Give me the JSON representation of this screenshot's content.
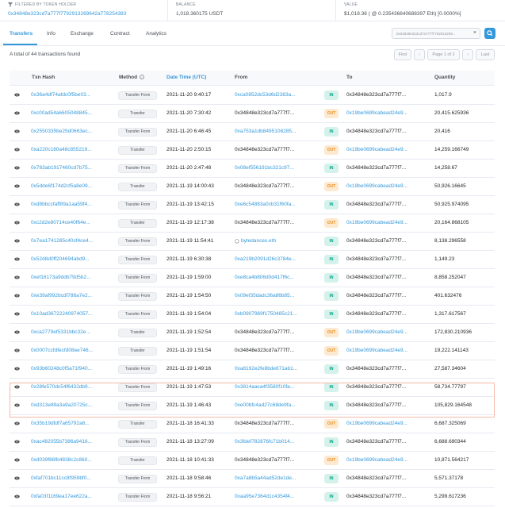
{
  "summary": {
    "filter_label": "FILTERED BY TOKEN HOLDER",
    "holder_address": "0x34848e323cd7a777f7792913269642a778254393",
    "balance_label": "BALANCE",
    "balance_value": "1,018.360175 USDT",
    "value_label": "VALUE",
    "value_value": "$1,018.36 ( @ 0.235436640688397 Eth) [0.0000%]"
  },
  "tabs": [
    "Transfers",
    "Info",
    "Exchange",
    "Contract",
    "Analytics"
  ],
  "search": {
    "value": "0x34848e323cd7a777f7792913269...",
    "clear": "×"
  },
  "total_text": "A total of 44 transactions found",
  "pagination": {
    "first": "First",
    "prev": "‹",
    "page": "Page 1 of 2",
    "next": "›",
    "last": "Last"
  },
  "columns": {
    "hash": "Txn Hash",
    "method": "Method",
    "age": "Date Time (UTC)",
    "from": "From",
    "to": "To",
    "qty": "Quantity"
  },
  "rows": [
    {
      "hash": "0x36a4df74afdc0f5be03...",
      "method": "Transfer From",
      "time": "2021-11-20 9:40:17",
      "from": "0xca0852dc53d6d2383a...",
      "dir": "IN",
      "to": "0x34848e323cd7a777f7...",
      "qty": "1,017.9"
    },
    {
      "hash": "0xc00ad54a6605048845...",
      "method": "Transfer",
      "time": "2021-11-20 7:30:42",
      "from": "0x34848e323cd7a777f7...",
      "dir": "OUT",
      "to": "0x19be0699cabead24e9...",
      "qty": "20,415.625936"
    },
    {
      "hash": "0x2550335be25d0663ec...",
      "method": "Transfer From",
      "time": "2021-11-20 6:46:45",
      "from": "0xa753a1db8495108285...",
      "dir": "IN",
      "to": "0x34848e323cd7a777f7...",
      "qty": "20,416"
    },
    {
      "hash": "0xa220c180a48c855219...",
      "method": "Transfer",
      "time": "2021-11-20 2:50:15",
      "from": "0x34848e323cd7a777f7...",
      "dir": "OUT",
      "to": "0x19be0699cabead24e9...",
      "qty": "14,259.166749"
    },
    {
      "hash": "0x783ab1917460cd7b75...",
      "method": "Transfer From",
      "time": "2021-11-20 2:47:48",
      "from": "0x08ef556191bc321c97...",
      "dir": "IN",
      "to": "0x34848e323cd7a777f7...",
      "qty": "14,258.67"
    },
    {
      "hash": "0x5dde6f174d2cf5a8e09...",
      "method": "Transfer",
      "time": "2021-11-19 14:00:43",
      "from": "0x34848e323cd7a777f7...",
      "dir": "OUT",
      "to": "0x19be0699cabead24e9...",
      "qty": "50,926.16645"
    },
    {
      "hash": "0xd8bbccfaff89a1aa59f4...",
      "method": "Transfer From",
      "time": "2021-11-19 13:42:15",
      "from": "0xe6c54883a0cb31f60fa...",
      "dir": "IN",
      "to": "0x34848e323cd7a777f7...",
      "qty": "50,925.974095"
    },
    {
      "hash": "0xc2d2e80714ce40f64e...",
      "method": "Transfer",
      "time": "2021-11-19 12:17:38",
      "from": "0x34848e323cd7a777f7...",
      "dir": "OUT",
      "to": "0x19be0699cabead24e9...",
      "qty": "20,164.868105"
    },
    {
      "hash": "0x7ea1741285c40cf4ce4...",
      "method": "Transfer From",
      "time": "2021-11-19 11:54:41",
      "from": "bytedances.eth",
      "fromIcon": true,
      "dir": "IN",
      "to": "0x34848e323cd7a777f7...",
      "qty": "8,138.296558"
    },
    {
      "hash": "0x52d8d0ff204694abd9...",
      "method": "Transfer From",
      "time": "2021-11-19 6:30:38",
      "from": "0xa219b2091d26c3784e...",
      "dir": "IN",
      "to": "0x34848e323cd7a777f7...",
      "qty": "1,149.23"
    },
    {
      "hash": "0xef16173a9ddb79d5b2...",
      "method": "Transfer From",
      "time": "2021-11-19 1:59:00",
      "from": "0xe8ca4b806d0d417f6c...",
      "dir": "IN",
      "to": "0x34848e323cd7a777f7...",
      "qty": "8,858.252047"
    },
    {
      "hash": "0xe39af992bcdf788a7e2...",
      "method": "Transfer From",
      "time": "2021-11-19 1:54:50",
      "from": "0x09ef35dadc36a86b85...",
      "dir": "IN",
      "to": "0x34848e323cd7a777f7...",
      "qty": "401.632476"
    },
    {
      "hash": "0x10ad36722240974057...",
      "method": "Transfer From",
      "time": "2021-11-19 1:54:04",
      "from": "0xb0907969f1750485c21...",
      "dir": "IN",
      "to": "0x34848e323cd7a777f7...",
      "qty": "1,317.617567"
    },
    {
      "hash": "0xca2779ef5331bbc32e...",
      "method": "Transfer",
      "time": "2021-11-19 1:52:54",
      "from": "0x34848e323cd7a777f7...",
      "dir": "OUT",
      "to": "0x19be0699cabead24e9...",
      "qty": "172,830.210936"
    },
    {
      "hash": "0x0007ccfdfecfd08ee746...",
      "method": "Transfer",
      "time": "2021-11-19 1:51:54",
      "from": "0x34848e323cd7a777f7...",
      "dir": "OUT",
      "to": "0x19be0699cabead24e9...",
      "qty": "19,222.141143"
    },
    {
      "hash": "0x93b60248c0f5a71f940...",
      "method": "Transfer From",
      "time": "2021-11-19 1:49:16",
      "from": "0xa8192e2fe8bde671ab1...",
      "dir": "IN",
      "to": "0x34848e323cd7a777f7...",
      "qty": "27,587.34604"
    },
    {
      "hash": "0x28fe570dc54f6432db9...",
      "method": "Transfer From",
      "time": "2021-11-19 1:47:53",
      "from": "0x3814aaca4f3580f10fa...",
      "dir": "IN",
      "to": "0x34848e323cd7a777f7...",
      "qty": "58,734.77797"
    },
    {
      "hash": "0xd313e89a3a9a20725c...",
      "method": "Transfer From",
      "time": "2021-11-19 1:46:43",
      "from": "0xe00bfc4ad27c68de9fa...",
      "dir": "IN",
      "to": "0x34848e323cd7a777f7...",
      "qty": "105,829.164548"
    },
    {
      "hash": "0x35b19dfdf7a65792a6...",
      "method": "Transfer",
      "time": "2021-11-18 16:41:33",
      "from": "0x34848e323cd7a777f7...",
      "dir": "OUT",
      "to": "0x19be0699cabead24e9...",
      "qty": "6,687.325069"
    },
    {
      "hash": "0xac482055b7386a9416...",
      "method": "Transfer From",
      "time": "2021-11-18 13:27:09",
      "from": "0x3fdef782876fc71b014...",
      "dir": "IN",
      "to": "0x34848e323cd7a777f7...",
      "qty": "6,688.690344"
    },
    {
      "hash": "0xd039f86fb4838c2c860...",
      "method": "Transfer",
      "time": "2021-11-18 10:41:33",
      "from": "0x34848e323cd7a777f7...",
      "dir": "OUT",
      "to": "0x19be0699cabead24e9...",
      "qty": "10,871.564217"
    },
    {
      "hash": "0xfaf701bc11cc8f959bf0...",
      "method": "Transfer From",
      "time": "2021-11-18 9:58:46",
      "from": "0xa7a8b5a44ad52de1de...",
      "dir": "IN",
      "to": "0x34848e323cd7a777f7...",
      "qty": "5,571.37178"
    },
    {
      "hash": "0xfa03f1169ea17ee622a...",
      "method": "Transfer From",
      "time": "2021-11-18 9:56:21",
      "from": "0xaa95e7364d1c4354f4...",
      "dir": "IN",
      "to": "0x34848e323cd7a777f7...",
      "qty": "5,299.617236"
    }
  ]
}
